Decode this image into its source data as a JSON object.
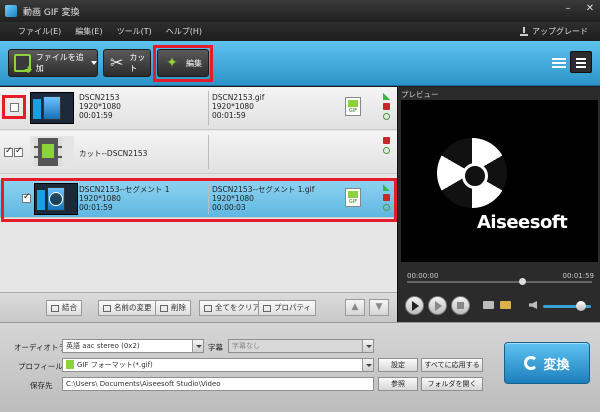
{
  "title_bar": {
    "app_title": "動画 GIF 変換"
  },
  "menu": {
    "items": [
      "ファイル(E)",
      "編集(E)",
      "ツール(T)",
      "ヘルプ(H)"
    ],
    "upgrade": "アップグレード"
  },
  "toolbar": {
    "add_file": "ファイルを追加",
    "cut": "カット",
    "edit": "編集"
  },
  "files": [
    {
      "name": "DSCN2153",
      "resolution": "1920*1080",
      "duration": "00:01:59",
      "output_name": "DSCN2153.gif",
      "output_resolution": "1920*1080",
      "output_duration": "00:01:59",
      "format": "GIF"
    },
    {
      "name": "カット--DSCN2153"
    },
    {
      "name": "DSCN2153--セグメント 1",
      "resolution": "1920*1080",
      "duration": "00:01:59",
      "output_name": "DSCN2153--セグメント 1.gif",
      "output_resolution": "1920*1080",
      "output_duration": "00:00:03",
      "format": "GIF"
    }
  ],
  "actions": {
    "merge": "結合",
    "rename": "名前の変更",
    "delete": "削除",
    "clear_all": "全てをクリア",
    "properties": "プロパティ"
  },
  "preview": {
    "label": "プレビュー",
    "logo_text": "Aiseesoft",
    "time_current": "00:00:00",
    "time_total": "00:01:59",
    "progress_fraction": 0.62,
    "volume_fraction": 0.8
  },
  "settings": {
    "audio_track_label": "オーディオトラック",
    "audio_track_value": "英語 aac stereo (0x2)",
    "subtitle_label": "字幕",
    "subtitle_value": "字幕なし",
    "profile_label": "プロフィール",
    "profile_value": "GIF フォーマット(*.gif)",
    "settings_button": "設定",
    "apply_all_button": "すべてに応用する",
    "destination_label": "保存先",
    "destination_value": "C:\\Users\\        Documents\\Aiseesoft Studio\\Video",
    "browse_button": "参照",
    "open_folder_button": "フォルダを開く",
    "convert_button": "変換"
  },
  "colors": {
    "accent_blue": "#2b93c9",
    "highlight_red": "#e51d2a",
    "selected_row": "#6fc0e8"
  }
}
